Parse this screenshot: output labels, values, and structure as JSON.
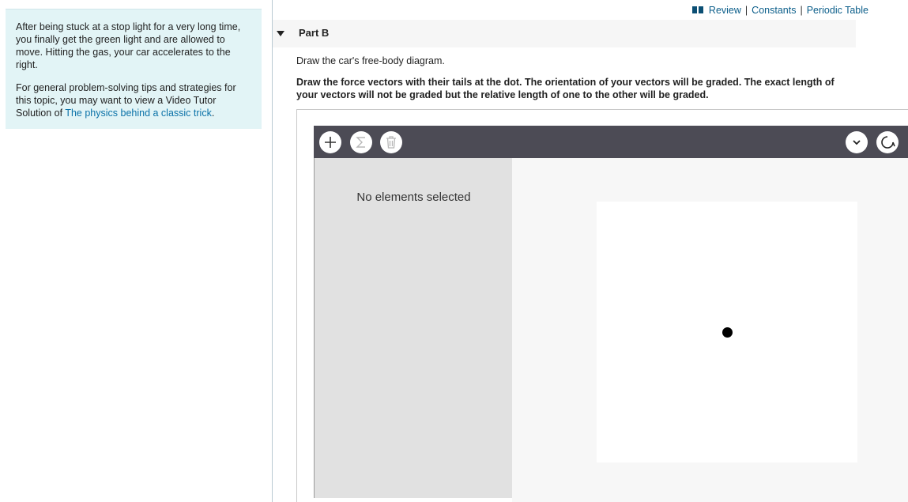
{
  "problem": {
    "paragraph1": "After being stuck at a stop light for a very long time, you finally get the green light and are allowed to move.  Hitting the gas, your car accelerates to the right.",
    "paragraph2_prefix": "For general problem-solving tips and strategies for this topic, you may want to view a Video Tutor Solution of ",
    "paragraph2_link": "The physics behind a classic trick",
    "paragraph2_suffix": "."
  },
  "top_links": {
    "review": "Review",
    "separator": "|",
    "constants": "Constants",
    "periodic_table": "Periodic Table"
  },
  "part": {
    "title": "Part B",
    "instruction": "Draw the car's free-body diagram.",
    "bold_instruction": "Draw the force vectors with their tails at the dot. The orientation of your vectors will be graded. The exact length of your vectors will not be graded but the relative length of one to the other will be graded."
  },
  "tool": {
    "buttons": [
      "plus-icon",
      "sigma-icon",
      "trash-icon",
      "chevron-down-icon",
      "reset-icon"
    ],
    "empty_message": "No elements selected"
  },
  "colors": {
    "panel_bg": "#e2f4f6",
    "link": "#0b72a8",
    "toolbar": "#4c4b55",
    "side_panel": "#e1e1e1"
  }
}
